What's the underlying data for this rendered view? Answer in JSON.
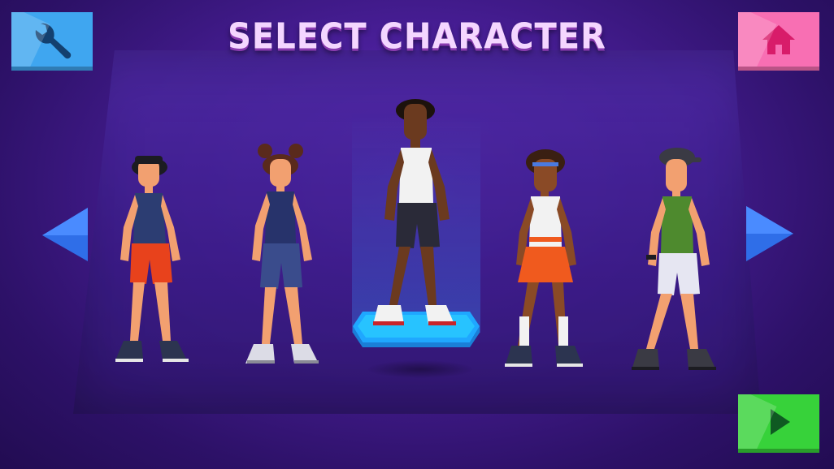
{
  "screen": {
    "title": "SELECT CHARACTER"
  },
  "buttons": {
    "settings": {
      "icon": "wrench-icon",
      "color": "#3fa6f0"
    },
    "home": {
      "icon": "home-icon",
      "color": "#f86fb3"
    },
    "play": {
      "icon": "play-icon",
      "color": "#37d23a"
    }
  },
  "navigation": {
    "previous_icon": "arrow-left-icon",
    "next_icon": "arrow-right-icon",
    "arrow_color": "#2f6ee8"
  },
  "characters": [
    {
      "id": "runner-1",
      "selected": false,
      "top_color": "#2c3d72",
      "bottom_color": "#e8421c",
      "skin": "#f2a070",
      "hair": "#1c1c22",
      "hat": true,
      "hat_color": "#1c1c22"
    },
    {
      "id": "runner-2",
      "selected": false,
      "top_color": "#27336b",
      "bottom_color": "#3a4c8c",
      "skin": "#f2a070",
      "hair": "#5a2a1c",
      "hat": false
    },
    {
      "id": "runner-3",
      "selected": true,
      "top_color": "#f2f2f2",
      "bottom_color": "#2a2a38",
      "skin": "#6b3a1f",
      "hair": "#1c120c",
      "hat": false
    },
    {
      "id": "runner-4",
      "selected": false,
      "top_color": "#f2f2f2",
      "bottom_color": "#f05a1e",
      "skin": "#8a4a26",
      "hair": "#3a1f12",
      "hat": false
    },
    {
      "id": "runner-5",
      "selected": false,
      "top_color": "#4e8a2e",
      "bottom_color": "#e6e6f2",
      "skin": "#f2a070",
      "hair": "#2a2a2e",
      "hat": true,
      "hat_color": "#3a3a44"
    }
  ],
  "selected_index": 2,
  "colors": {
    "background": "#3a1a88",
    "title_fill": "#f4d6ff",
    "pedestal": "#27c3ff"
  }
}
